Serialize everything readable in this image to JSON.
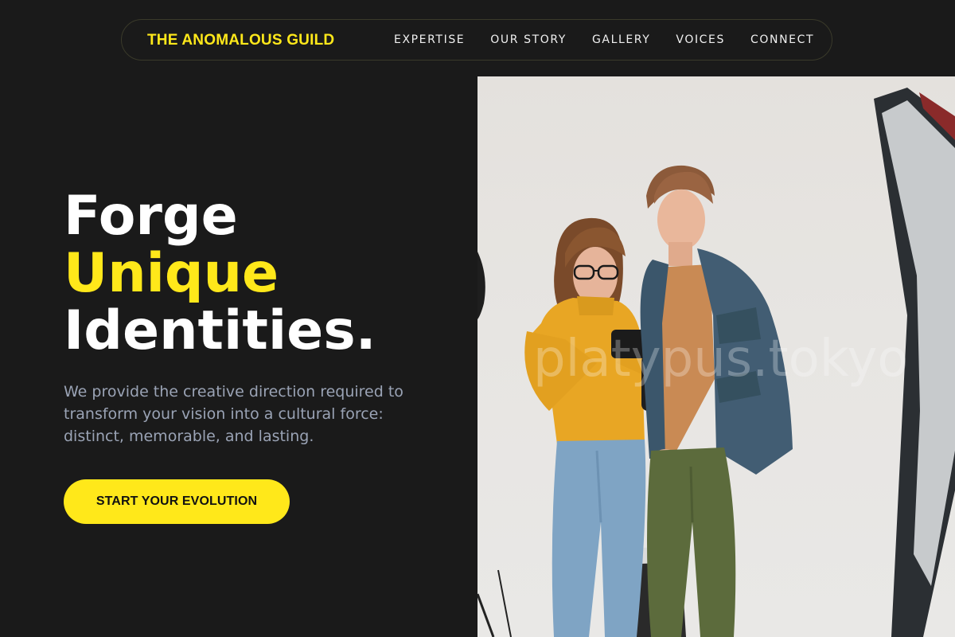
{
  "nav": {
    "brand": "THE ANOMALOUS GUILD",
    "links": [
      {
        "label": "EXPERTISE"
      },
      {
        "label": "OUR STORY"
      },
      {
        "label": "GALLERY"
      },
      {
        "label": "VOICES"
      },
      {
        "label": "CONNECT"
      }
    ]
  },
  "hero": {
    "headline": {
      "line1": "Forge",
      "line2": "Unique",
      "line3": "Identities."
    },
    "subtext": "We provide the creative direction required to transform your vision into a cultural force: distinct, memorable, and lasting.",
    "cta_label": "START YOUR EVOLUTION"
  },
  "photo": {
    "watermark": "platypus.tokyo"
  },
  "colors": {
    "background": "#1a1a1a",
    "accent": "#ffe81a",
    "body_text": "#9aa3b5",
    "heading": "#ffffff"
  }
}
